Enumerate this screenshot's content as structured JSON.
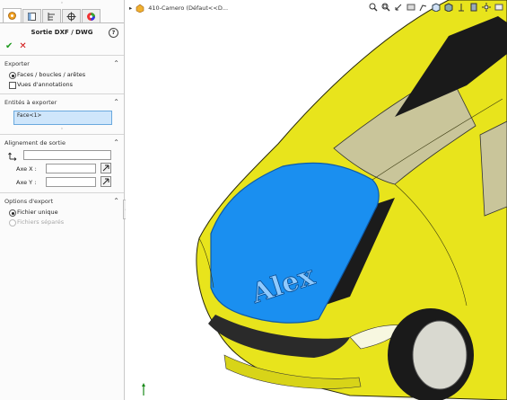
{
  "tabs": [
    {
      "icon": "feature-manager-icon",
      "active": true
    },
    {
      "icon": "property-manager-icon",
      "active": false
    },
    {
      "icon": "configuration-manager-icon",
      "active": false
    },
    {
      "icon": "dimxpert-icon",
      "active": false
    },
    {
      "icon": "display-manager-icon",
      "active": false
    }
  ],
  "title": "Sortie DXF / DWG",
  "export": {
    "title": "Exporter",
    "options": [
      "Faces / boucles / arêtes",
      "Vues d'annotations"
    ],
    "selected": 0
  },
  "entities": {
    "title": "Entités à exporter",
    "value": "Face<1>"
  },
  "alignment": {
    "title": "Alignement de sortie",
    "x_label": "Axe X :",
    "y_label": "Axe Y :"
  },
  "export_options": {
    "title": "Options d'export",
    "options": [
      "Fichier unique",
      "Fichiers séparés"
    ],
    "selected": 0
  },
  "viewport": {
    "tree_label": "410-Camero (Défaut<<D...",
    "hood_text": "Alex",
    "colors": {
      "body": "#e8e41c",
      "hood": "#1a8ff0",
      "glass": "#c9c59a"
    }
  }
}
